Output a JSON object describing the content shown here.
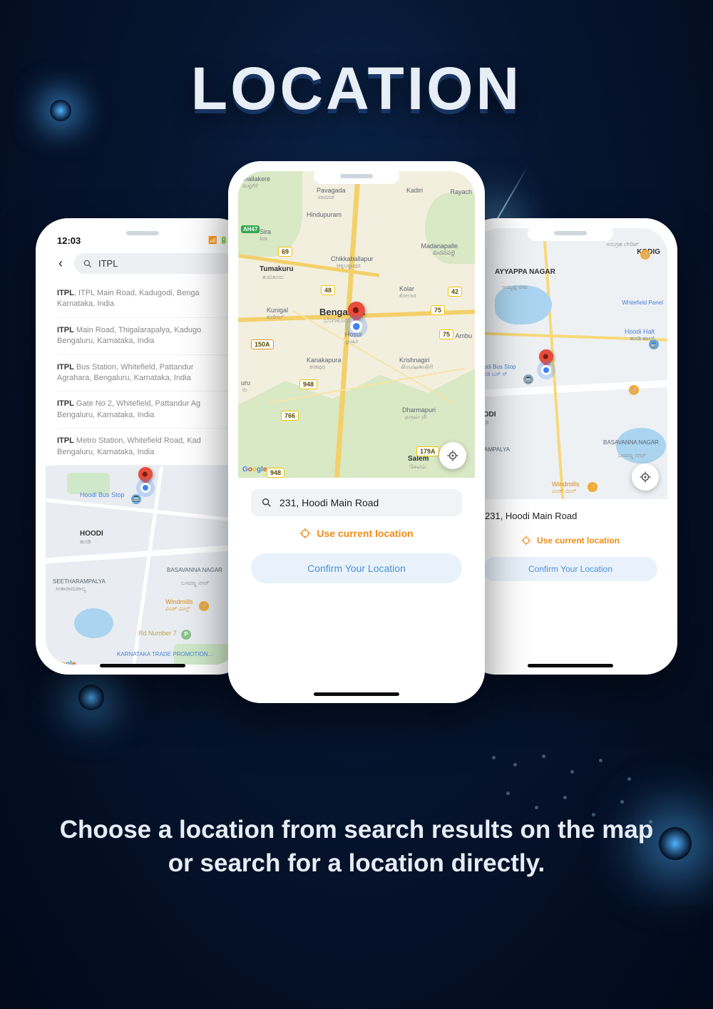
{
  "heading": "LOCATION",
  "caption": "Choose a location from search results on the map or search for a location directly.",
  "accent_orange": "#f08b18",
  "accent_blue": "#4d8fd6",
  "left_phone": {
    "status_time": "12:03",
    "search_value": "ITPL",
    "results": [
      {
        "bold": "ITPL",
        "rest": ", ITPL Main Road, Kadugodi, Benga",
        "line2": "Karnataka, India"
      },
      {
        "bold": "ITPL",
        "rest": " Main Road, Thigalarapalya, Kadugo",
        "line2": "Bengaluru, Karnataka, India"
      },
      {
        "bold": "ITPL",
        "rest": " Bus Station, Whitefield, Pattandur",
        "line2": "Agrahara, Bengaluru, Karnataka, India"
      },
      {
        "bold": "ITPL",
        "rest": " Gate No 2, Whitefield, Pattandur Ag",
        "line2": "Bengaluru, Karnataka, India"
      },
      {
        "bold": "ITPL",
        "rest": " Metro Station, Whitefield Road, Kad",
        "line2": "Bengaluru, Karnataka, India"
      }
    ],
    "map_labels": {
      "bus_stop": "Hoodi Bus Stop",
      "hoodi_en": "HOODI",
      "hoodi_knd": "ಹೂಡಿ",
      "seeth_en": "SEETHARAMPALYA",
      "seeth_knd": "ಸೀತಾರಾಮಪಾಲ್ಯ",
      "basav_en": "BASAVANNA NAGAR",
      "basav_knd": "ಬಸವಣ್ಣ ನಗರ್",
      "windmills": "Windmills",
      "windmills_knd": "ವಿಂಡ್ ಮಿಲ್ಸ್",
      "rd7": "Rd Number 7",
      "karnataka_trade": "KARNATAKA TRADE PROMOTION..."
    }
  },
  "center_phone": {
    "labels": {
      "mallakere": "mallakere",
      "mallakere_knd": "ಮಳ್ಳಗೆರೆ",
      "pavagada": "Pavagada",
      "pavagada_knd": "ಪಾವಗಡ",
      "kadiri": "Kadiri",
      "rayach": "Rayach",
      "hindupuram": "Hindupuram",
      "sira": "Sira",
      "sira_knd": "ಸಿರಾ",
      "madanapalle": "Madanapalle",
      "madanapalle_knd": "మదనపల్లె",
      "chikkaballapur": "Chikkaballapur",
      "chikkaballapur_knd": "ಚಿಕ್ಕಬಳ್ಳಾಪುರ",
      "tumakuru": "Tumakuru",
      "tumakuru_knd": "ತುಮಕೂರು",
      "kolar": "Kolar",
      "kolar_knd": "ಕೋಲಾರ",
      "kunigal": "Kunigal",
      "kunigal_knd": "ಕುಣಿಗಲ್",
      "bengaluru": "Bengaluru",
      "bengaluru_knd": "ಬೆಂಗಳೂರು",
      "hosur": "Hosur",
      "hosur_knd": "ஓசூர்",
      "ambur": "Ambu",
      "kanakapura": "Kanakapura",
      "kanakapura_knd": "ಕನಕಪುರ",
      "krishnagiri": "Krishnagiri",
      "krishnagiri_knd": "கிருஷ்ணகிரி",
      "uru": "uru",
      "uru_knd": "ರು",
      "dharmapuri": "Dharmapuri",
      "dharmapuri_knd": "தரும்புரி",
      "salem": "Salem",
      "salem_knd": "சேலம்"
    },
    "road_badges": [
      "AH47",
      "69",
      "48",
      "75",
      "42",
      "150A",
      "75",
      "948",
      "766",
      "179A",
      "948"
    ],
    "address_value": "231, Hoodi Main Road",
    "use_current": "Use current location",
    "confirm": "Confirm Your Location"
  },
  "right_phone": {
    "labels": {
      "kodig": "KODIG",
      "kodig_knd": "ಅನುಗ್ರಹ ಲೇಔಟ್",
      "ayyappa_en": "AYYAPPA NAGAR",
      "ayyappa_knd": "ಅಯ್ಯಪ್ಪ ನಗರ",
      "whitefield_panel": "Whitefield Panel",
      "hoodi_halt": "Hoodi Halt",
      "hoodi_halt_knd": "ಹೂಡಿ ಹಾಲ್ಟ್",
      "hoodi_bus": "Hoodi Bus Stop",
      "hoodi_bus_knd": "ಹೂಡಿ ಬಸ್ ಸ್",
      "oodi": "OODI",
      "oodi_knd": "ಹೂಡಿ",
      "arampalya": "ARAMPALYA",
      "basavanna": "BASAVANNA NAGAR",
      "basavanna_knd": "ಬಸವಣ್ಣ ನಗರ್",
      "windmills": "Windmills",
      "windmills_knd": "ವಿಂಡ್ ಮಿಲ್"
    },
    "address_value": "231, Hoodi Main Road",
    "use_current": "Use current location",
    "confirm": "Confirm Your Location"
  }
}
